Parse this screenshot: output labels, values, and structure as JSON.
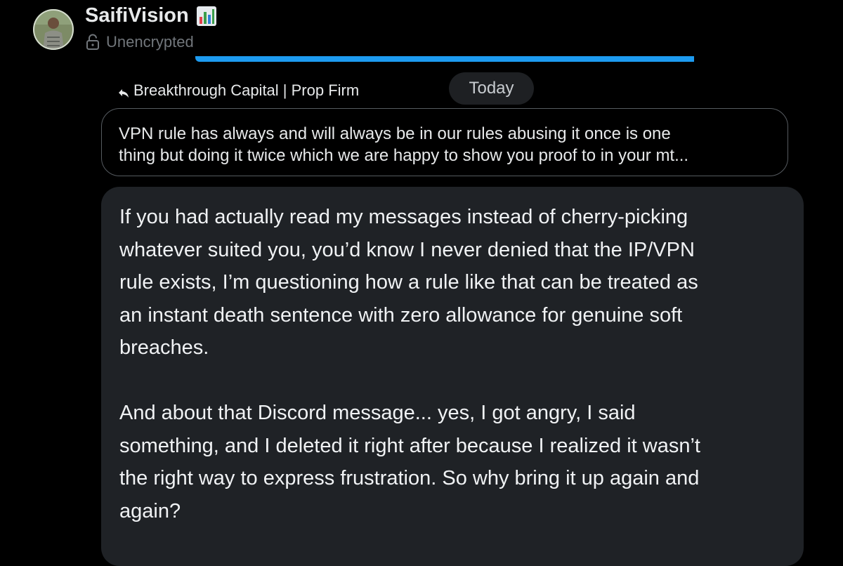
{
  "header": {
    "user_name": "SaifiVision",
    "name_emoji": "bar-chart-emoji",
    "encryption_status": "Unencrypted",
    "load_progress": 0.77,
    "accent_color": "#1d9bf0"
  },
  "conversation": {
    "reply_to_label": "Breakthrough Capital | Prop Firm",
    "date_separator": "Today",
    "quoted_message": {
      "lines": [
        "VPN rule has always and will always be in our rules abusing it once is one",
        "thing but doing it twice which we are happy to show you proof to in your mt..."
      ]
    },
    "message": {
      "paragraph_1": [
        "If you had actually read my messages instead of cherry-picking",
        "whatever suited you, you’d know I never denied that the IP/VPN",
        "rule exists, I’m questioning how a rule like that can be treated as",
        "an instant death sentence with zero allowance for genuine soft",
        "breaches."
      ],
      "paragraph_2": [
        "And about that Discord message... yes, I got angry, I said",
        "something, and I deleted it right after because I realized it wasn’t",
        "the right way to express frustration. So why bring it up again and",
        "again?"
      ]
    }
  }
}
